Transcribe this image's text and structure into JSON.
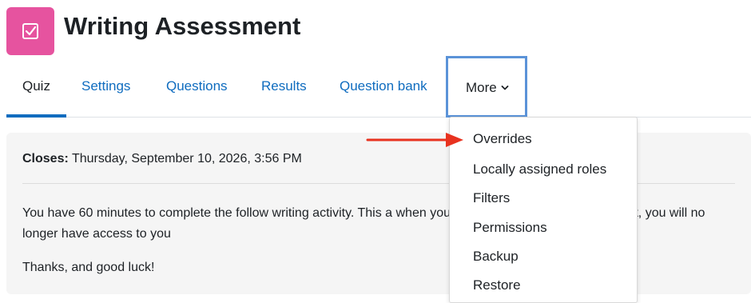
{
  "page": {
    "title": "Writing Assessment"
  },
  "nav": {
    "tabs": [
      "Quiz",
      "Settings",
      "Questions",
      "Results",
      "Question bank"
    ],
    "more_label": "More"
  },
  "info": {
    "closes_label": "Closes:",
    "closes_value": " Thursday, September 10, 2026, 3:56 PM",
    "paragraph": "You have 60 minutes to complete the follow writing activity.  This a                                          when you have completed and submitted it, you will no longer have access to you",
    "thanks": "Thanks, and good luck!"
  },
  "dropdown": {
    "items": [
      "Overrides",
      "Locally assigned roles",
      "Filters",
      "Permissions",
      "Backup",
      "Restore"
    ]
  },
  "colors": {
    "icon_bg": "#e6539f",
    "link": "#0f6cbf",
    "highlight_border": "#5b93d8",
    "arrow": "#e8321f"
  }
}
